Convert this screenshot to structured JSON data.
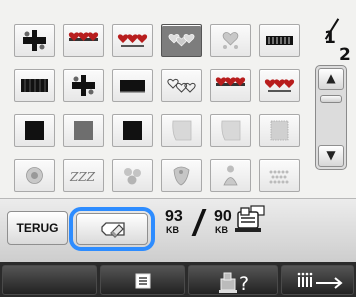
{
  "page": {
    "current": "1",
    "total": "2"
  },
  "scroll": {
    "up_icon": "triangle-up",
    "down_icon": "triangle-down"
  },
  "patterns": [
    {
      "icon": "black-flower-ribbon",
      "selected": false
    },
    {
      "icon": "red-hearts-ribbon",
      "selected": false
    },
    {
      "icon": "red-hearts-ribbon-small",
      "selected": false
    },
    {
      "icon": "silver-hearts",
      "selected": true
    },
    {
      "icon": "grey-heart-cluster",
      "selected": false
    },
    {
      "icon": "black-barcode-band",
      "selected": false
    },
    {
      "icon": "black-bar-pattern",
      "selected": false
    },
    {
      "icon": "black-flower-ribbon",
      "selected": false
    },
    {
      "icon": "black-solid-bar",
      "selected": false
    },
    {
      "icon": "red-outline-hearts",
      "selected": false
    },
    {
      "icon": "red-hearts-ribbon",
      "selected": false
    },
    {
      "icon": "red-hearts-ribbon-small",
      "selected": false
    },
    {
      "icon": "black-square",
      "selected": false
    },
    {
      "icon": "grey-square",
      "selected": false
    },
    {
      "icon": "black-square",
      "selected": false
    },
    {
      "icon": "light-curved-square",
      "selected": false
    },
    {
      "icon": "light-curved-square",
      "selected": false
    },
    {
      "icon": "light-dotted-square",
      "selected": false
    },
    {
      "icon": "grey-round-motif",
      "selected": false
    },
    {
      "icon": "grey-script-motif",
      "selected": false
    },
    {
      "icon": "grey-floral-motif",
      "selected": false
    },
    {
      "icon": "grey-bird-motif",
      "selected": false
    },
    {
      "icon": "grey-figure-motif",
      "selected": false
    },
    {
      "icon": "grey-scroll-motif",
      "selected": false
    }
  ],
  "toolbar": {
    "back_label": "TERUG",
    "erase_icon": "eraser-icon",
    "memory_used": "93",
    "memory_used_unit": "KB",
    "memory_total": "90",
    "memory_total_unit": "KB",
    "machine_icon": "embroidery-machine-icon"
  },
  "bottom_bar": {
    "list_icon": "list-icon",
    "help_icon": "machine-help-icon",
    "nav_icon": "needle-arrow-icon"
  },
  "colors": {
    "selection_ring": "#2d8cff",
    "bottom_bar": "#2b2b2b",
    "red_motif": "#b81d1d"
  }
}
